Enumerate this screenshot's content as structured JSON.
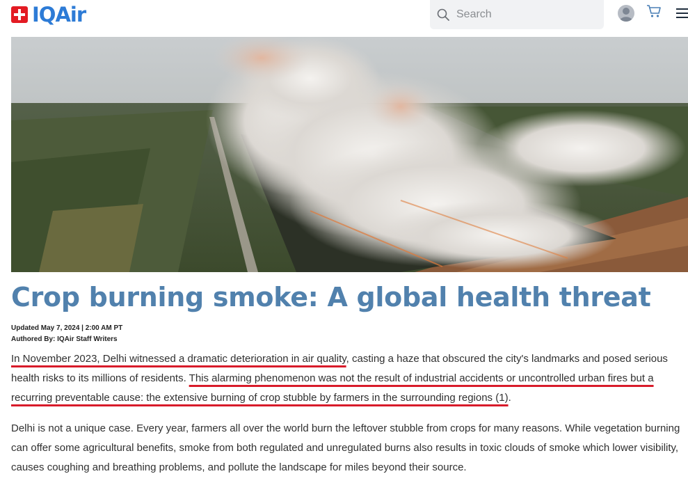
{
  "header": {
    "logo_text": "IQAir",
    "search_placeholder": "Search",
    "icons": [
      "search-icon",
      "user-avatar-icon",
      "cart-icon",
      "menu-icon"
    ]
  },
  "hero": {
    "image_description": "Aerial view of crop fields burning with large clouds of white smoke"
  },
  "article": {
    "title": "Crop burning smoke: A global health threat",
    "updated": "Updated May 7, 2024 | 2:00 AM PT",
    "author": "Authored By: IQAir Staff Writers",
    "p1_seg1": "In November 2023, Delhi witnessed a dramatic deterioration in air quality",
    "p1_seg2": ", casting a haze that obscured the city's landmarks and posed serious health risks to its millions of residents. ",
    "p1_seg3": "This alarming phenomenon was not the result of industrial accidents or uncontrolled urban fires but a recurring preventable cause: the extensive burning of crop stubble by farmers in the surrounding regions (1)",
    "p1_seg4": ".",
    "p2": "Delhi is not a unique case. Every year, farmers all over the world burn the leftover stubble from crops for many reasons. While vegetation burning can offer some agricultural benefits, smoke from both regulated and unregulated burns also results in toxic clouds of smoke which lower visibility, causes coughing and breathing problems, and pollute the landscape for miles beyond their source."
  },
  "colors": {
    "brand_red": "#e31b23",
    "brand_blue": "#2d7bd6",
    "title_blue": "#5181ad",
    "annotation_red": "#d81b2a"
  }
}
